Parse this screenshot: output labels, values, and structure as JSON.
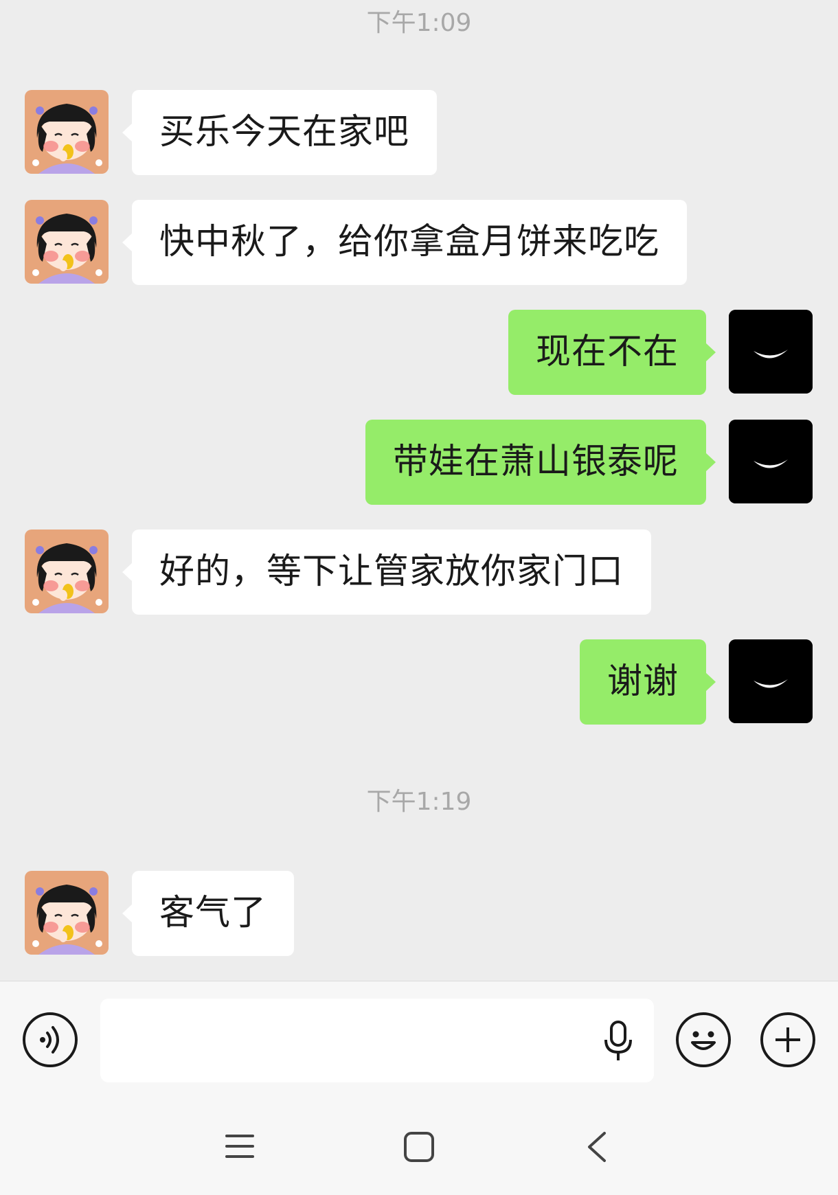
{
  "timestamps": [
    "下午1:09",
    "下午1:19"
  ],
  "messages": [
    {
      "side": "in",
      "text": "买乐今天在家吧"
    },
    {
      "side": "in",
      "text": "快中秋了，给你拿盒月饼来吃吃"
    },
    {
      "side": "out",
      "text": "现在不在"
    },
    {
      "side": "out",
      "text": "带娃在萧山银泰呢"
    },
    {
      "side": "in",
      "text": "好的，等下让管家放你家门口"
    },
    {
      "side": "out",
      "text": "谢谢"
    },
    {
      "side": "in",
      "text": "客气了"
    }
  ],
  "input": {
    "value": "",
    "placeholder": ""
  },
  "icons": {
    "voice": "voice-toggle-icon",
    "mic": "microphone-icon",
    "emoji": "emoji-icon",
    "plus": "plus-icon",
    "nav_menu": "recent-apps-icon",
    "nav_home": "home-icon",
    "nav_back": "back-icon"
  },
  "colors": {
    "background": "#ededed",
    "incoming_bubble": "#ffffff",
    "outgoing_bubble": "#95ec69",
    "timestamp": "#a8a8a8"
  }
}
